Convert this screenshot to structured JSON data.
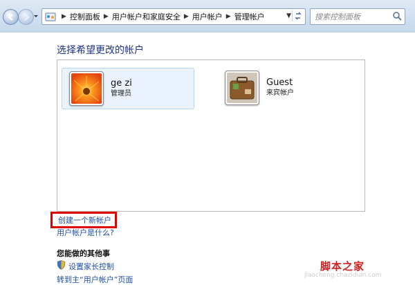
{
  "nav": {
    "breadcrumbs": [
      "控制面板",
      "用户帐户和家庭安全",
      "用户帐户",
      "管理帐户"
    ],
    "search_placeholder": "搜索控制面板"
  },
  "main": {
    "heading": "选择希望更改的帐户",
    "accounts": [
      {
        "name": "ge zi",
        "role": "管理员"
      },
      {
        "name": "Guest",
        "role": "来宾帐户"
      }
    ],
    "create_account_link": "创建一个新帐户",
    "what_is_account_link": "用户帐户是什么?",
    "other_heading": "您能做的其他事",
    "parental_control_link": "设置家长控制",
    "goto_user_accounts_link": "转到主“用户帐户”页面"
  },
  "watermark": {
    "text": "脚本之家",
    "url": "jiaocheng.chazidian.com"
  },
  "colors": {
    "link": "#1e4fa8",
    "heading": "#1e3287",
    "highlight_border": "#e00000"
  }
}
